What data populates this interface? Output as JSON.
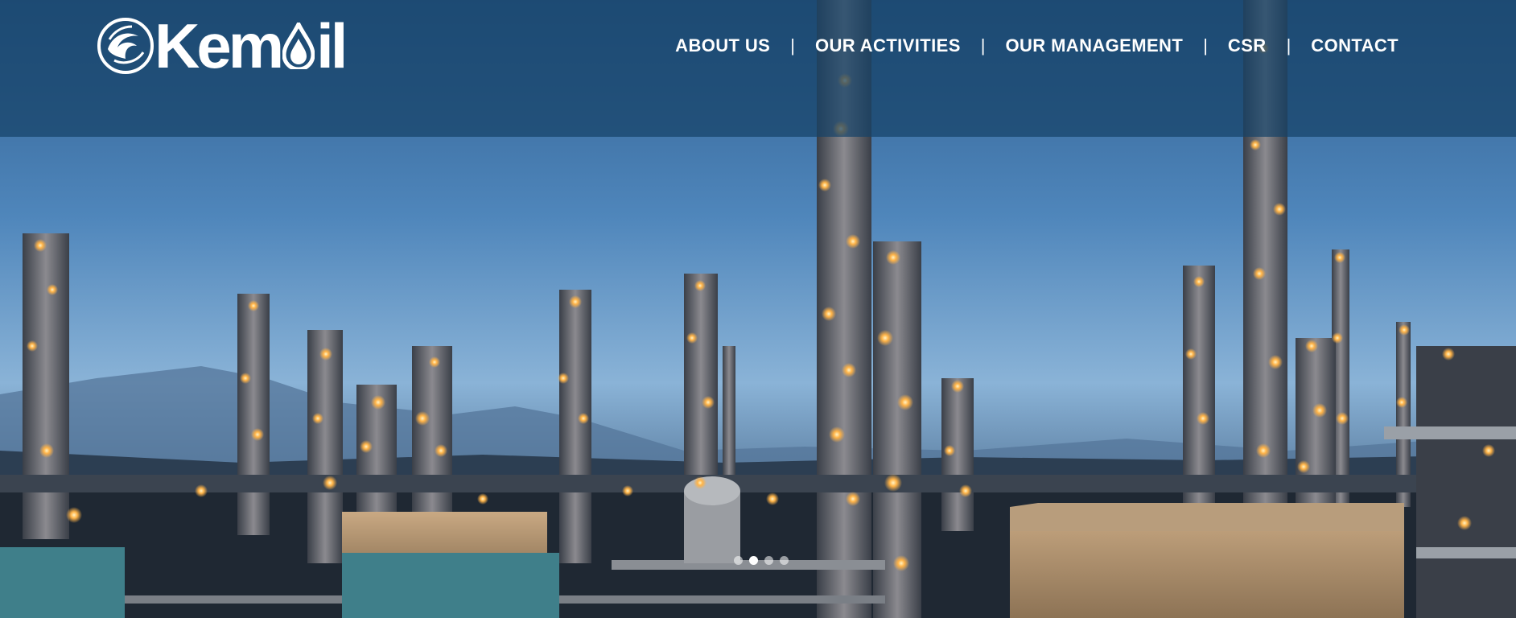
{
  "logo": {
    "text_prefix": "Kem",
    "text_suffix": "il",
    "emblem_icon": "globe-swirl-icon",
    "drop_icon": "oil-drop-icon"
  },
  "nav": {
    "items": [
      {
        "label": "ABOUT US"
      },
      {
        "label": "OUR ACTIVITIES"
      },
      {
        "label": "OUR MANAGEMENT"
      },
      {
        "label": "CSR"
      },
      {
        "label": "CONTACT"
      }
    ],
    "separator": "|"
  },
  "hero": {
    "image": "oil-refinery-at-dusk",
    "slides_total": 4,
    "active_slide": 2
  },
  "colors": {
    "header_overlay": "#164268",
    "nav_text": "#ffffff",
    "sky": "#4a7fb3",
    "refinery_light": "#ffb347"
  }
}
